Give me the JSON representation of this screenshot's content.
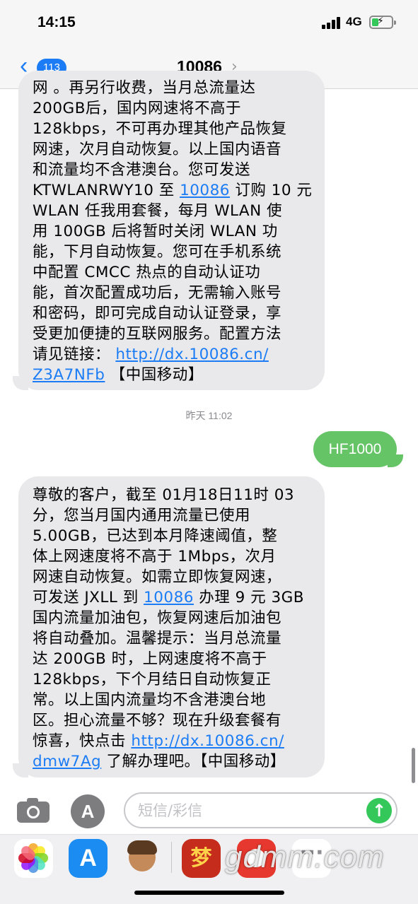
{
  "status_bar": {
    "time": "14:15",
    "network": "4G"
  },
  "nav": {
    "back_badge": "113",
    "contact": "10086"
  },
  "messages": {
    "msg1_lines": [
      "网 。再另行收费，当月总流量达",
      "200GB后，国内网速将不高于",
      "128kbps，不可再办理其他产品恢复",
      "网速，次月自动恢复。以上国内语音",
      "和流量均不含港澳台。您可发送",
      "KTWLANRWY10 至 ",
      "WLAN 任我用套餐，每月 WLAN 使",
      "用 100GB 后将暂时关闭 WLAN 功",
      "能，下月自动恢复。您可在手机系统",
      "中配置 CMCC 热点的自动认证功",
      "能，首次配置成功后，无需输入账号",
      "和密码，即可完成自动认证登录，享",
      "受更加便捷的互联网服务。配置方法",
      "请见链接： "
    ],
    "msg1_link_number": "10086",
    "msg1_after_number": " 订购 10 元",
    "msg1_link_url_a": "http://dx.10086.cn/",
    "msg1_link_url_b": "Z3A7NFb",
    "msg1_tail": " 【中国移动】",
    "timestamp": "昨天 11:02",
    "sent": "HF1000",
    "msg2_lines": [
      "尊敬的客户，截至 01月18日11时 03",
      "分，您当月国内通用流量已使用",
      "5.00GB，已达到本月降速阈值，整",
      "体上网速度将不高于 1Mbps，次月",
      "网速自动恢复。如需立即恢复网速，",
      "可发送 JXLL 到 ",
      "国内流量加油包，恢复网速后加油包",
      "将自动叠加。温馨提示：当月总流量",
      "达 200GB 时，上网速度将不高于",
      "128kbps，下个月结日自动恢复正",
      "常。以上国内流量均不含港澳台地",
      "区。担心流量不够？现在升级套餐有",
      "惊喜，快点击 "
    ],
    "msg2_link_number": "10086",
    "msg2_after_number": " 办理 9 元 3GB",
    "msg2_link_url_a": "http://dx.10086.cn/",
    "msg2_link_url_b": "dmw7Ag",
    "msg2_tail": " 了解办理吧。【中国移动】"
  },
  "input": {
    "placeholder": "短信/彩信"
  },
  "watermark": "gdmm.com",
  "colors": {
    "accent": "#1b7cf5",
    "incoming_bubble": "#e9e9eb",
    "outgoing_bubble": "#65c466"
  }
}
